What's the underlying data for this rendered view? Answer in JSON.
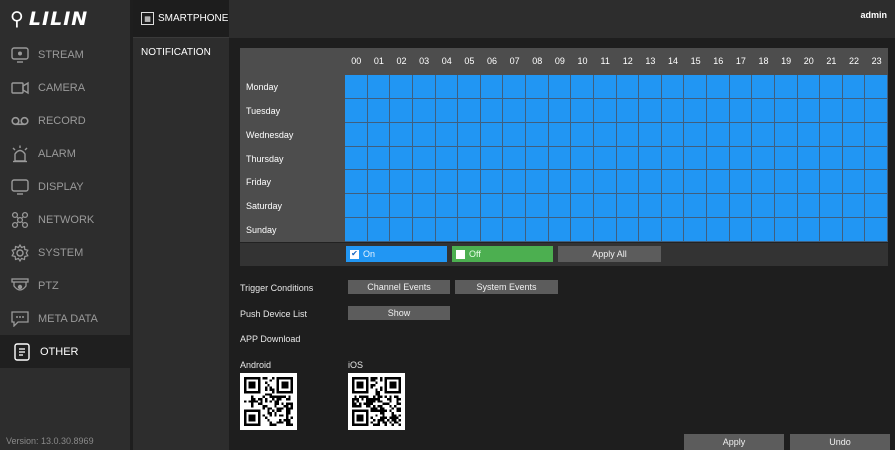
{
  "brand": {
    "logo_text": "LILIN"
  },
  "sidebar": {
    "items": [
      {
        "label": "STREAM",
        "icon": "stream-icon"
      },
      {
        "label": "CAMERA",
        "icon": "camera-icon"
      },
      {
        "label": "RECORD",
        "icon": "record-icon"
      },
      {
        "label": "ALARM",
        "icon": "alarm-icon"
      },
      {
        "label": "DISPLAY",
        "icon": "display-icon"
      },
      {
        "label": "NETWORK",
        "icon": "network-icon"
      },
      {
        "label": "SYSTEM",
        "icon": "system-icon"
      },
      {
        "label": "PTZ",
        "icon": "ptz-icon"
      },
      {
        "label": "META DATA",
        "icon": "meta-data-icon"
      },
      {
        "label": "OTHER",
        "icon": "other-icon",
        "active": true
      }
    ],
    "version": "Version: 13.0.30.8969"
  },
  "submenu": {
    "items": [
      {
        "label": "SMARTPHONE",
        "icon": "smartphone-icon"
      },
      {
        "label": "NOTIFICATION"
      }
    ]
  },
  "topbar": {
    "user": "admin"
  },
  "schedule": {
    "hours": [
      "00",
      "01",
      "02",
      "03",
      "04",
      "05",
      "06",
      "07",
      "08",
      "09",
      "10",
      "11",
      "12",
      "13",
      "14",
      "15",
      "16",
      "17",
      "18",
      "19",
      "20",
      "21",
      "22",
      "23"
    ],
    "days": [
      "Monday",
      "Tuesday",
      "Wednesday",
      "Thursday",
      "Friday",
      "Saturday",
      "Sunday"
    ],
    "all_on": true,
    "legend_on": "On",
    "legend_off": "Off",
    "apply_all": "Apply All",
    "colors": {
      "on": "#2196f3",
      "off": "#4caf50"
    }
  },
  "trigger": {
    "label": "Trigger Conditions",
    "channel_events": "Channel Events",
    "system_events": "System Events"
  },
  "push": {
    "label": "Push Device List",
    "show": "Show"
  },
  "app": {
    "label": "APP Download",
    "android": "Android",
    "ios": "iOS"
  },
  "footer": {
    "apply": "Apply",
    "undo": "Undo"
  }
}
